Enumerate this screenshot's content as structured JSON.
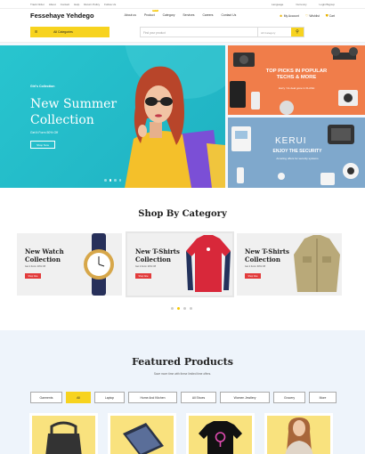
{
  "topbar": {
    "links": [
      "Track Order",
      "About",
      "Contact",
      "Help",
      "Return Policy",
      "Follow Us"
    ],
    "right": [
      "Language",
      "Currency",
      "Login/Signup"
    ]
  },
  "header": {
    "logo": "Fessehaye Yehdego",
    "nav": [
      "About us",
      "Product",
      "Category",
      "Services",
      "Careers",
      "Contact Us"
    ],
    "new_badge": "NEW",
    "account": "My Account",
    "wishlist": "Wishlist",
    "cart": "Cart"
  },
  "search": {
    "all_categories": "All Categories",
    "placeholder": "Find your product",
    "category": "All Category"
  },
  "hero": {
    "tag": "Girl's Collection",
    "title": "New Summer Collection",
    "sub": "Get it Form 50% Off",
    "button": "Shop Now",
    "slides": 4,
    "active_slide": 2
  },
  "promo1": {
    "title": "TOP PICKS IN POPULAR TECHS & MORE",
    "sub": "Hurry ! its deal gone in FLASH"
  },
  "promo2": {
    "brand": "KERUI",
    "title": "ENJOY THE SECURITY",
    "sub": "Amazing offers for security systems"
  },
  "categories": {
    "title": "Shop By Category",
    "cards": [
      {
        "title": "New Watch Collection",
        "sub": "Get it Form 40% Off",
        "button": "Shop Now"
      },
      {
        "title": "New T-Shirts Collection",
        "sub": "Get it Form 20% Off",
        "button": "Shop Now"
      },
      {
        "title": "New T-Shirts Collection",
        "sub": "Get it Form 60% Off",
        "button": "Shop Now"
      }
    ]
  },
  "featured": {
    "title": "Featured Products",
    "sub": "Save more time with these limited time offers.",
    "tabs": [
      "Garments",
      "All",
      "Laptop",
      "Home And Kitchen",
      "All Shoes",
      "Women Jewllery",
      "Grocery",
      "More"
    ],
    "active_tab": 1
  },
  "colors": {
    "accent": "#f7d31f",
    "hero_bg": "#28c5cf",
    "promo_orange": "#f07d4a",
    "promo_blue": "#7fa8cc",
    "shop_red": "#e23b3b"
  }
}
